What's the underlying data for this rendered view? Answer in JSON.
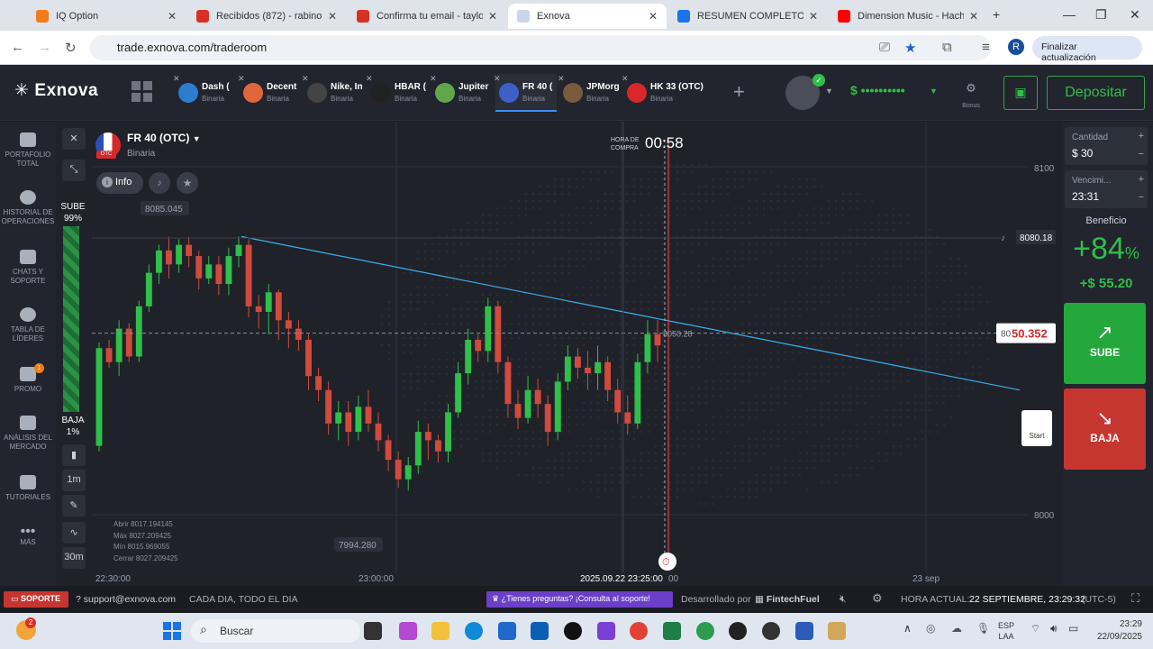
{
  "browser": {
    "tabs": [
      {
        "label": "IQ Option",
        "color": "#f07d1a"
      },
      {
        "label": "Recibidos (872) - rabinoin",
        "color": "#d93025"
      },
      {
        "label": "Confirma tu email - taylor",
        "color": "#d93025"
      },
      {
        "label": "Exnova",
        "color": "#c9d6ee",
        "active": true
      },
      {
        "label": "RESUMEN COMPLETO",
        "color": "#1a73e8"
      },
      {
        "label": "Dimension Music - Hachik",
        "color": "#ff0000"
      }
    ],
    "url": "trade.exnova.com/traderoom",
    "update_button": "Finalizar actualización",
    "profile_letter": "R"
  },
  "header": {
    "logo": "Exnova",
    "assets": [
      {
        "name": "Dash (",
        "type": "Binaria",
        "color": "#2c7dd0"
      },
      {
        "name": "Decent",
        "type": "Binaria",
        "color": "#e0673a"
      },
      {
        "name": "Nike, In",
        "type": "Binaria",
        "color": "#444"
      },
      {
        "name": "HBAR (",
        "type": "Binaria",
        "color": "#222"
      },
      {
        "name": "Jupiter",
        "type": "Binaria",
        "color": "#5ea84a"
      },
      {
        "name": "FR 40 (",
        "type": "Binaria",
        "color": "#3e5fc7",
        "active": true
      },
      {
        "name": "JPMorg",
        "type": "Binaria",
        "color": "#7a5a3a"
      },
      {
        "name": "HK 33 (OTC)",
        "type": "Binaria",
        "color": "#d8282b"
      }
    ],
    "balance": "$ ••••••••••",
    "bonus_label": "Bonus",
    "deposit_label": "Depositar"
  },
  "sidebar": {
    "items": [
      {
        "label": "PORTAFOLIO TOTAL"
      },
      {
        "label": "HISTORIAL DE OPERACIONES"
      },
      {
        "label": "CHATS Y SOPORTE"
      },
      {
        "label": "TABLA DE LÍDERES"
      },
      {
        "label": "PROMO",
        "badge": "1"
      },
      {
        "label": "ANÁLISIS DEL MERCADO"
      },
      {
        "label": "TUTORIALES"
      },
      {
        "label": "MÁS"
      }
    ]
  },
  "chart_header": {
    "asset_name": "FR 40 (OTC)",
    "asset_type": "Binaria",
    "info_label": "Info",
    "hora_label": "HORA DE COMPRA",
    "countdown": "00:58",
    "sube_label": "SUBE",
    "sube_pct": "99%",
    "baja_label": "BAJA",
    "baja_pct": "1%",
    "timeframe": "1m",
    "period": "30m",
    "start_label": "Start",
    "ohlc": [
      "Abrir 8017.194145",
      "Máx 8027.209425",
      "Mín 8015.969055",
      "Cerrar 8027.209425"
    ]
  },
  "chart_data": {
    "type": "candlestick",
    "ylim": [
      7985,
      8110
    ],
    "y_ticks": [
      "8100",
      "8000"
    ],
    "x_ticks": [
      "22:30:00",
      "23:00:00",
      "2025.09.22 23:25:00",
      "00",
      "23 sep"
    ],
    "high_label": "8085.045",
    "low_label": "7994.280",
    "current_price": "8050.352",
    "current_price_prefix": "80",
    "current_price_main": "50.352",
    "alert_price": "8080.18",
    "trendline_label": "8050.28",
    "candles": [
      [
        8010,
        8045,
        8008,
        8047
      ],
      [
        8045,
        8040,
        8038,
        8048
      ],
      [
        8040,
        8052,
        8035,
        8055
      ],
      [
        8052,
        8042,
        8040,
        8054
      ],
      [
        8042,
        8060,
        8040,
        8062
      ],
      [
        8060,
        8072,
        8058,
        8075
      ],
      [
        8072,
        8080,
        8068,
        8082
      ],
      [
        8080,
        8075,
        8070,
        8085
      ],
      [
        8075,
        8082,
        8072,
        8084
      ],
      [
        8082,
        8078,
        8074,
        8085
      ],
      [
        8078,
        8070,
        8066,
        8080
      ],
      [
        8070,
        8075,
        8068,
        8078
      ],
      [
        8075,
        8068,
        8064,
        8078
      ],
      [
        8068,
        8078,
        8064,
        8081
      ],
      [
        8078,
        8082,
        8074,
        8085
      ],
      [
        8082,
        8060,
        8056,
        8084
      ],
      [
        8060,
        8058,
        8052,
        8064
      ],
      [
        8058,
        8065,
        8050,
        8068
      ],
      [
        8065,
        8055,
        8048,
        8066
      ],
      [
        8055,
        8052,
        8045,
        8058
      ],
      [
        8052,
        8048,
        8044,
        8055
      ],
      [
        8048,
        8035,
        8030,
        8050
      ],
      [
        8035,
        8030,
        8026,
        8038
      ],
      [
        8030,
        8018,
        8014,
        8033
      ],
      [
        8018,
        8022,
        8012,
        8026
      ],
      [
        8022,
        8015,
        8010,
        8026
      ],
      [
        8015,
        8024,
        8012,
        8028
      ],
      [
        8024,
        8018,
        8015,
        8030
      ],
      [
        8018,
        8012,
        8008,
        8022
      ],
      [
        8012,
        8005,
        8001,
        8014
      ],
      [
        8005,
        7998,
        7995,
        8008
      ],
      [
        7998,
        8003,
        7994,
        8006
      ],
      [
        8003,
        8015,
        8000,
        8019
      ],
      [
        8015,
        8012,
        8005,
        8018
      ],
      [
        8012,
        8008,
        8004,
        8014
      ],
      [
        8008,
        8022,
        8004,
        8025
      ],
      [
        8022,
        8036,
        8020,
        8040
      ],
      [
        8036,
        8048,
        8032,
        8052
      ],
      [
        8048,
        8044,
        8040,
        8050
      ],
      [
        8044,
        8060,
        8040,
        8063
      ],
      [
        8060,
        8040,
        8036,
        8062
      ],
      [
        8040,
        8025,
        8020,
        8042
      ],
      [
        8025,
        8020,
        8016,
        8030
      ],
      [
        8020,
        8030,
        8018,
        8035
      ],
      [
        8030,
        8025,
        8020,
        8034
      ],
      [
        8025,
        8015,
        8010,
        8028
      ],
      [
        8015,
        8033,
        8012,
        8036
      ],
      [
        8033,
        8042,
        8030,
        8046
      ],
      [
        8042,
        8038,
        8034,
        8045
      ],
      [
        8038,
        8036,
        8030,
        8044
      ],
      [
        8036,
        8040,
        8030,
        8046
      ],
      [
        8040,
        8030,
        8026,
        8042
      ],
      [
        8030,
        8022,
        8018,
        8034
      ],
      [
        8022,
        8018,
        8014,
        8028
      ],
      [
        8018,
        8040,
        8016,
        8043
      ],
      [
        8040,
        8050,
        8036,
        8055
      ],
      [
        8050,
        8046,
        8040,
        8055
      ]
    ]
  },
  "right_panel": {
    "cantidad_label": "Cantidad",
    "cantidad_value": "$ 30",
    "venc_label": "Vencimi...",
    "venc_value": "23:31",
    "beneficio_label": "Beneficio",
    "beneficio_pct": "+84",
    "pct_sign": "%",
    "beneficio_amount": "+$ 55.20",
    "sube_label": "SUBE",
    "baja_label": "BAJA"
  },
  "footer": {
    "soporte": "SOPORTE",
    "email": "support@exnova.com",
    "schedule": "CADA DIA, TODO EL DIA",
    "promo": "¿Tienes preguntas? ¡Consulta al soporte!",
    "dev_by": "Desarrollado por",
    "dev_name": "FintechFuel",
    "time_label": "HORA ACTUAL:",
    "time_value": "22 SEPTIEMBRE, 23:29:32",
    "tz": "(UTC-5)"
  },
  "taskbar": {
    "search": "Buscar",
    "lang": "ESP",
    "lang2": "LAA",
    "time": "23:29",
    "date": "22/09/2025",
    "badge": "2"
  }
}
